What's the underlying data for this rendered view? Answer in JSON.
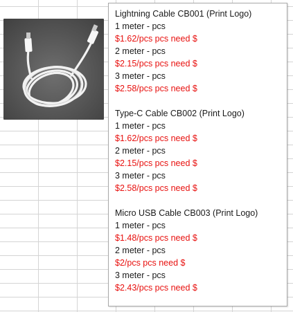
{
  "products": [
    {
      "title": "Lightning Cable CB001  (Print Logo)",
      "options": [
        {
          "length": "1 meter - pcs",
          "price": "$1.62/pcs pcs need $"
        },
        {
          "length": "2 meter - pcs",
          "price": "$2.15/pcs pcs need $"
        },
        {
          "length": "3 meter - pcs",
          "price": "$2.58/pcs pcs need $"
        }
      ]
    },
    {
      "title": "Type-C Cable CB002 (Print Logo)",
      "options": [
        {
          "length": "1 meter - pcs",
          "price": "$1.62/pcs pcs need $"
        },
        {
          "length": "2 meter - pcs",
          "price": "$2.15/pcs pcs need $"
        },
        {
          "length": "3 meter - pcs",
          "price": "$2.58/pcs pcs need $"
        }
      ]
    },
    {
      "title": "Micro USB Cable CB003  (Print Logo)",
      "options": [
        {
          "length": "1 meter - pcs",
          "price": "$1.48/pcs pcs need $"
        },
        {
          "length": "2 meter - pcs",
          "price": "$2/pcs pcs need $"
        },
        {
          "length": "3 meter - pcs",
          "price": "$2.43/pcs pcs need $"
        }
      ]
    }
  ],
  "colors": {
    "price_text": "#e8110f",
    "normal_text": "#1a1a1a",
    "gridline": "#d4d4d4",
    "comment_border": "#a8a8a8"
  },
  "images": {
    "product_photo": "white-usb-cable-photo"
  }
}
